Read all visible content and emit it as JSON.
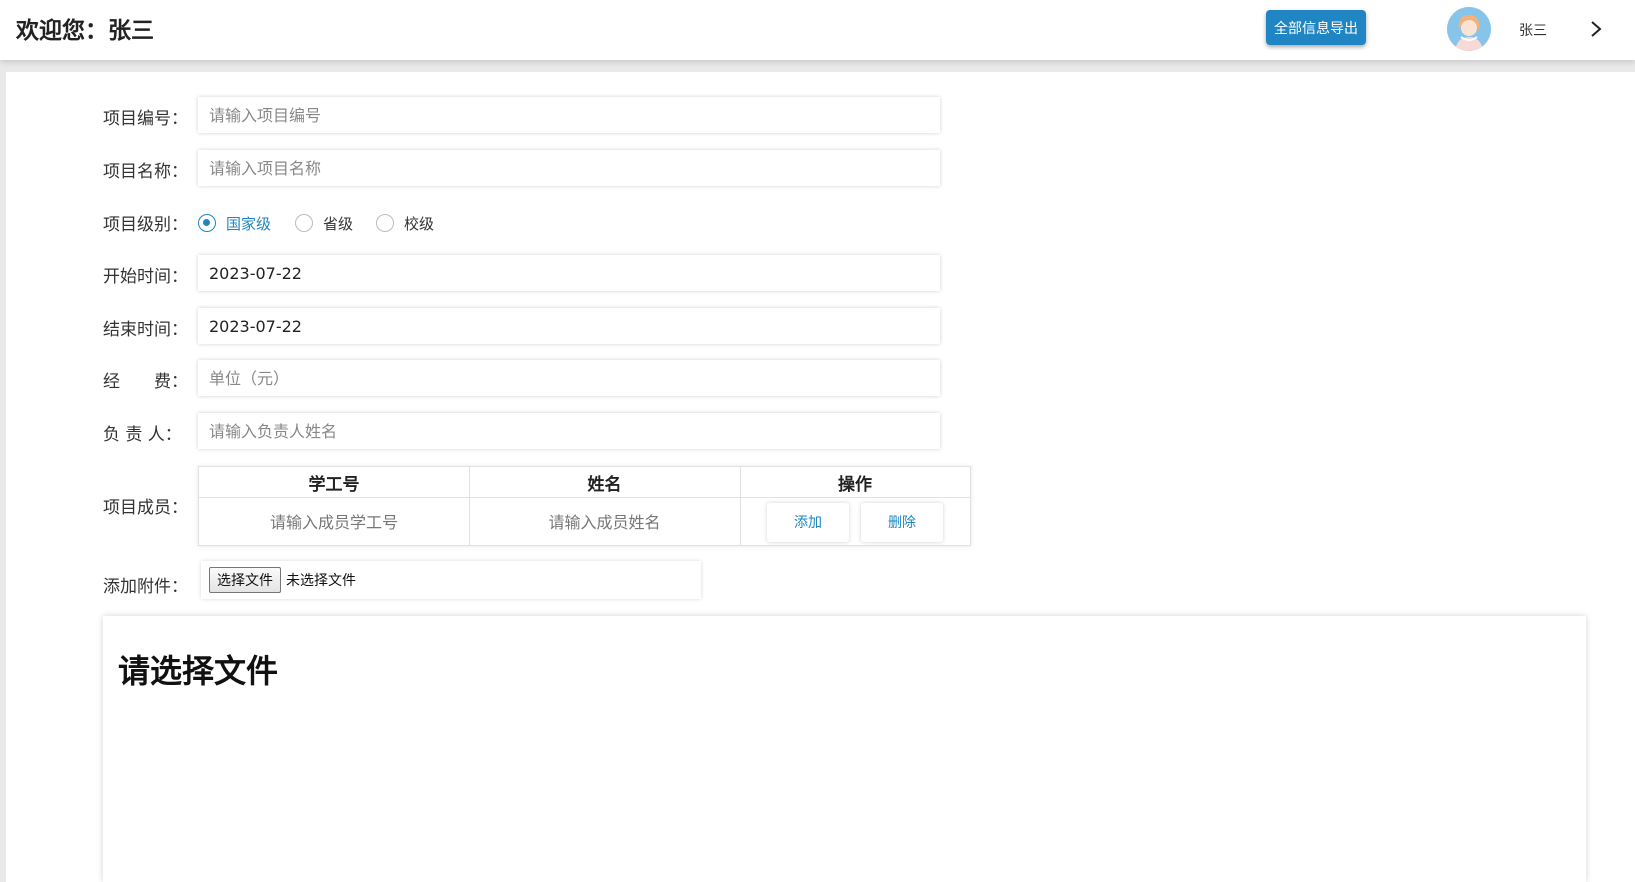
{
  "header": {
    "welcome": "欢迎您：张三",
    "export_label": "全部信息导出",
    "user_name": "张三",
    "accent_color": "#1f86c3"
  },
  "form": {
    "project_no": {
      "label": "项目编号：",
      "placeholder": "请输入项目编号"
    },
    "project_name": {
      "label": "项目名称：",
      "placeholder": "请输入项目名称"
    },
    "project_level": {
      "label": "项目级别：",
      "options": [
        "国家级",
        "省级",
        "校级"
      ],
      "selected": "国家级"
    },
    "start_time": {
      "label": "开始时间：",
      "value": "2023-07-22"
    },
    "end_time": {
      "label": "结束时间：",
      "value": "2023-07-22"
    },
    "funds": {
      "label": "经　　费：",
      "placeholder": "单位（元）"
    },
    "leader": {
      "label": "负  责  人：",
      "placeholder": "请输入负责人姓名"
    },
    "members": {
      "label": "项目成员：",
      "columns": [
        "学工号",
        "姓名",
        "操作"
      ],
      "id_placeholder": "请输入成员学工号",
      "name_placeholder": "请输入成员姓名",
      "add_label": "添加",
      "delete_label": "删除"
    },
    "attachment": {
      "label": "添加附件：",
      "button_label": "选择文件",
      "status": "未选择文件"
    }
  },
  "preview": {
    "heading": "请选择文件"
  }
}
